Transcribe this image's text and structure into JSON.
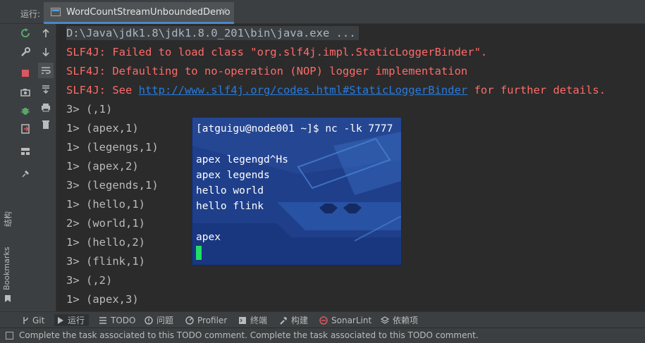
{
  "header": {
    "run_label": "运行:",
    "tab_title": "WordCountStreamUnboundedDemo",
    "tab_close": "×"
  },
  "left_stripe": {
    "structure_label": "结构",
    "bookmarks_label": "Bookmarks"
  },
  "console": {
    "cmd_line": "D:\\Java\\jdk1.8\\jdk1.8.0_201\\bin\\java.exe ...",
    "err1": "SLF4J: Failed to load class \"org.slf4j.impl.StaticLoggerBinder\".",
    "err2": "SLF4J: Defaulting to no-operation (NOP) logger implementation",
    "err3_prefix": "SLF4J: See ",
    "err3_link": "http://www.slf4j.org/codes.html#StaticLoggerBinder",
    "err3_suffix": " for further details.",
    "outputs": [
      "3> (,1)",
      "1> (apex,1)",
      "1> (legengs,1)",
      "1> (apex,2)",
      "3> (legends,1)",
      "1> (hello,1)",
      "2> (world,1)",
      "1> (hello,2)",
      "3> (flink,1)",
      "3> (,2)",
      "1> (apex,3)"
    ]
  },
  "terminal": {
    "prompt": "[atguigu@node001 ~]$ nc -lk 7777",
    "lines": [
      "apex legengd^Hs",
      "apex legends",
      "hello world",
      "hello flink",
      "",
      "apex"
    ]
  },
  "bottom_tabs": [
    {
      "icon": "git-icon",
      "label": "Git"
    },
    {
      "icon": "run-icon",
      "label": "运行"
    },
    {
      "icon": "todo-icon",
      "label": "TODO"
    },
    {
      "icon": "problems-icon",
      "label": "问题"
    },
    {
      "icon": "profiler-icon",
      "label": "Profiler"
    },
    {
      "icon": "terminal-icon",
      "label": "终端"
    },
    {
      "icon": "build-icon",
      "label": "构建"
    },
    {
      "icon": "sonarlint-icon",
      "label": "SonarLint"
    },
    {
      "icon": "dependencies-icon",
      "label": "依赖项"
    }
  ],
  "status": {
    "text": "Complete the task associated to this TODO comment. Complete the task associated to this TODO comment."
  },
  "colors": {
    "error": "#ff6b68",
    "link": "#287bde",
    "accent": "#4a88c7",
    "terminal_bg": "#1f3f8a",
    "cursor": "#22dd66"
  }
}
